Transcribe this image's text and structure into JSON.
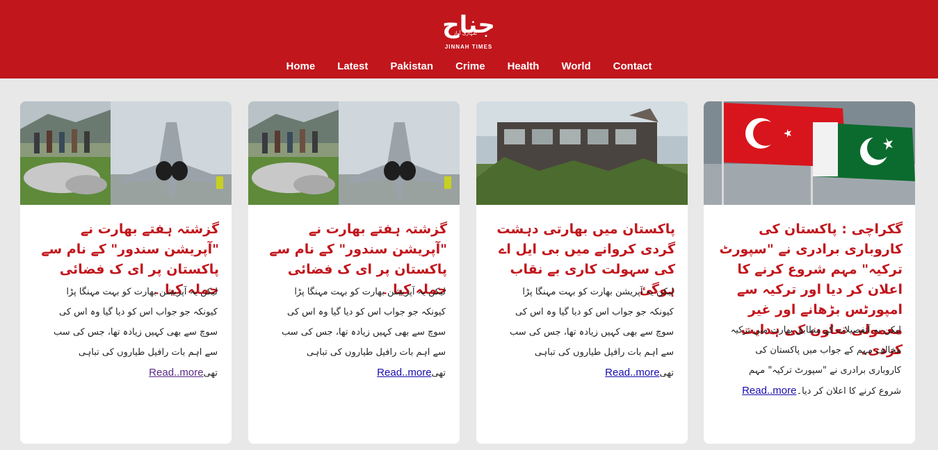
{
  "header": {
    "logo_main": "جناح",
    "logo_tagline": "تمہاری آواز",
    "logo_sub": "JINNAH TIMES",
    "nav": [
      "Home",
      "Latest",
      "Pakistan",
      "Crime",
      "Health",
      "World",
      "Contact"
    ]
  },
  "articles": [
    {
      "title": "گزشتہ ہفتے بھارت نے \"آپریشن سندور\" کے نام سے پاکستان پر ای ک فضائی حملہ کیا ۔",
      "excerpt": "لیکن یہ آپریشن بھارت کو بہت مہنگا پڑا کیونکہ جو جواب اس کو دیا گیا وہ اس کی سوچ سے بھی کہیں زیادہ تھا، جس کی سب سے اہم بات رافیل طیاروں کی تباہی تھی",
      "read_more": "Read..more",
      "image": "rafale-jet-wreckage-icon"
    },
    {
      "title": "گزشتہ ہفتے بھارت نے \"آپریشن سندور\" کے نام سے پاکستان پر ای ک فضائی حملہ کیا ۔",
      "excerpt": "لیکن یہ آپریشن بھارت کو بہت مہنگا پڑا کیونکہ جو جواب اس کو دیا گیا وہ اس کی سوچ سے بھی کہیں زیادہ تھا، جس کی سب سے اہم بات رافیل طیاروں کی تباہی تھی",
      "read_more": "Read..more",
      "image": "rafale-jet-wreckage-icon"
    },
    {
      "title": "پاکستان میں بھارتی دہشت گردی کروانے میں بی ایل اے کی سہولت کاری بے نقاب ہوگئ",
      "excerpt": "لیکن یہ آپریشن بھارت کو بہت مہنگا پڑا کیونکہ جو جواب اس کو دیا گیا وہ اس کی سوچ سے بھی کہیں زیادہ تھا، جس کی سب سے اہم بات رافیل طیاروں کی تباہی تھی",
      "read_more": "Read..more",
      "image": "burnt-bus-icon"
    },
    {
      "title": "گکراچی : پاکستان کی کاروباری برادری نے \"سپورٹ ترکیہ\" مہم شروع کرنے کا اعلان کر دیا اور ترکیہ سے امپورٹس بڑھانے اور غیر معمولی تعاون کی ہدایت کردی۔",
      "excerpt": "لیکن یہ آتفصیلات کے مطابق بھارت میں ترکیہ مخالف مہم کے جواب میں پاکستان کی کاروباری برادری نے \"سپورٹ ترکیہ\" مہم شروع کرنے کا اعلان کر دیا۔",
      "read_more": "Read..more",
      "image": "turkey-pakistan-flags-icon"
    }
  ]
}
